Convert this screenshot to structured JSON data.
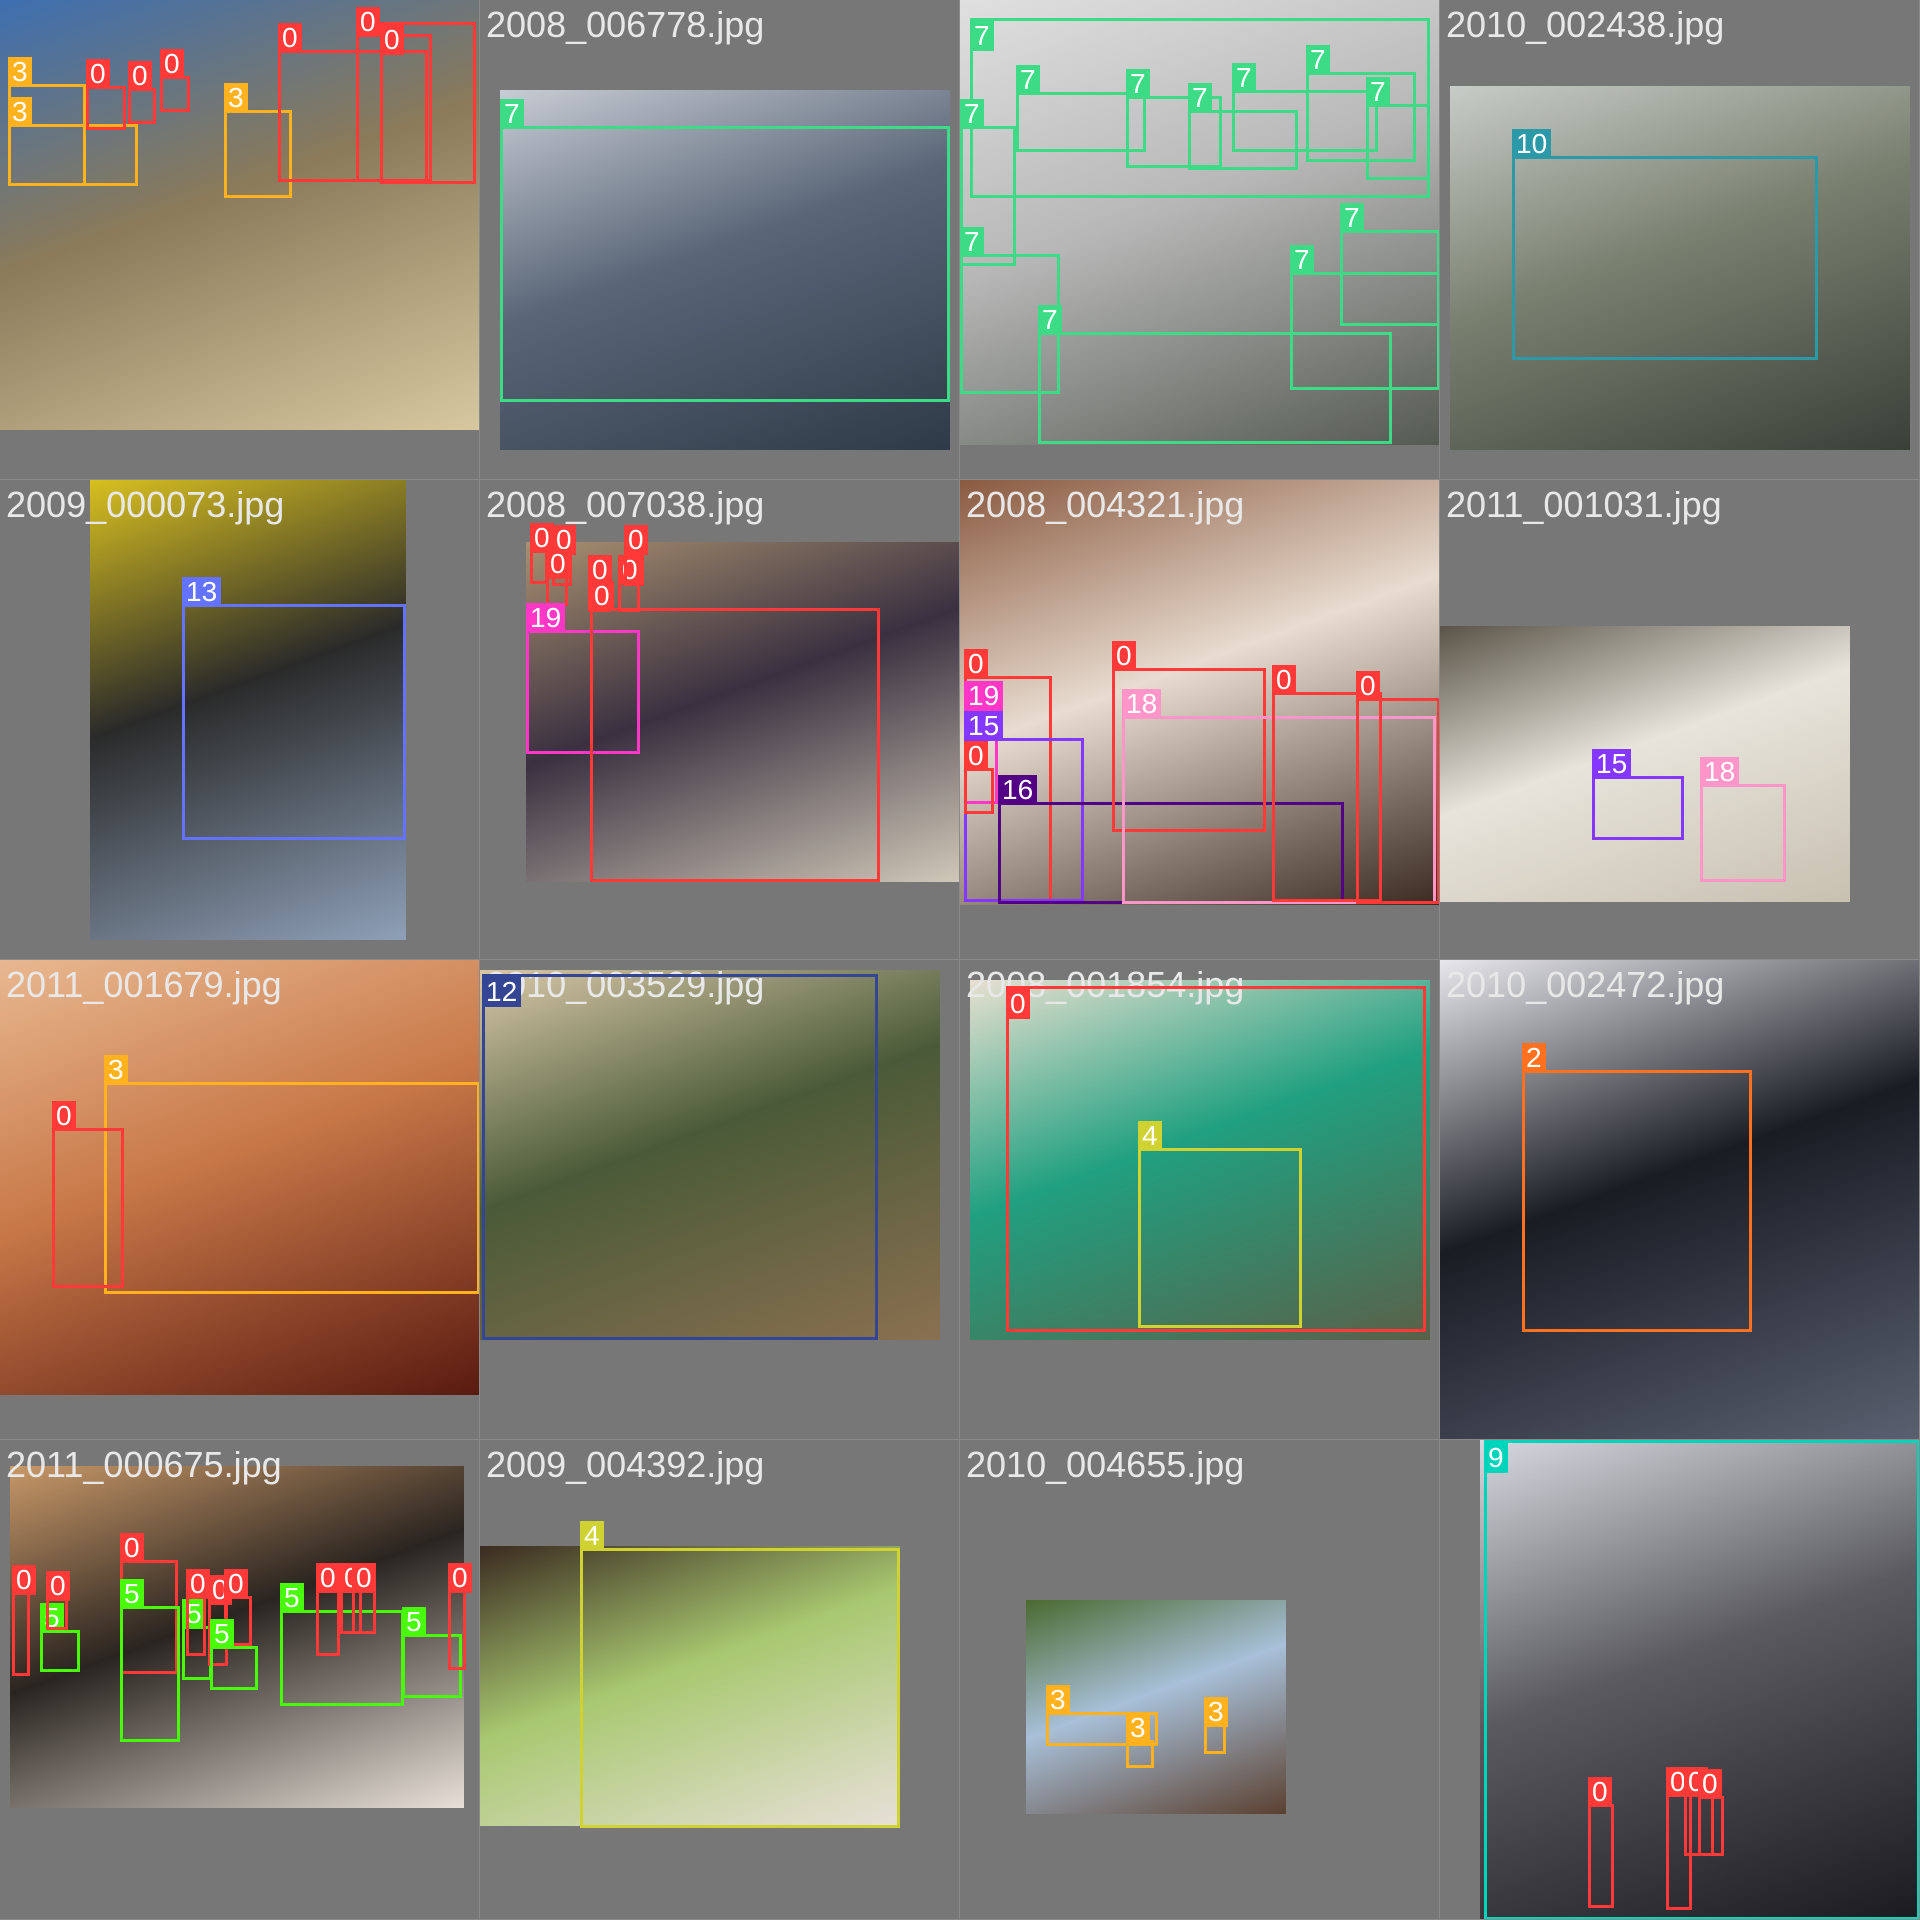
{
  "tiles": [
    {
      "filename": "",
      "photo_colors": [
        "#8a7a5a",
        "#3d6fb0",
        "#d8c8a0"
      ],
      "boxes": [
        {
          "label": "3",
          "color": "#FFB21D"
        },
        {
          "label": "3",
          "color": "#FFB21D"
        },
        {
          "label": "0",
          "color": "#FF3838"
        },
        {
          "label": "0",
          "color": "#FF3838"
        },
        {
          "label": "0",
          "color": "#FF3838"
        },
        {
          "label": "3",
          "color": "#FFB21D"
        },
        {
          "label": "0",
          "color": "#FF3838"
        },
        {
          "label": "0",
          "color": "#FF3838"
        },
        {
          "label": "0",
          "color": "#FF3838"
        }
      ]
    },
    {
      "filename": "2008_006778.jpg",
      "photo_colors": [
        "#5a6678",
        "#c8ccd4",
        "#2f3a48"
      ],
      "boxes": [
        {
          "label": "7",
          "color": "#3DDB86"
        }
      ]
    },
    {
      "filename": "",
      "photo_colors": [
        "#b8b8b8",
        "#e0e0e0",
        "#555a52"
      ],
      "boxes": [
        {
          "label": "7",
          "color": "#3DDB86"
        },
        {
          "label": "7",
          "color": "#3DDB86"
        },
        {
          "label": "7",
          "color": "#3DDB86"
        },
        {
          "label": "7",
          "color": "#3DDB86"
        },
        {
          "label": "7",
          "color": "#3DDB86"
        },
        {
          "label": "7",
          "color": "#3DDB86"
        },
        {
          "label": "7",
          "color": "#3DDB86"
        },
        {
          "label": "7",
          "color": "#3DDB86"
        },
        {
          "label": "7",
          "color": "#3DDB86"
        },
        {
          "label": "7",
          "color": "#3DDB86"
        },
        {
          "label": "7",
          "color": "#3DDB86"
        },
        {
          "label": "7",
          "color": "#3DDB86"
        }
      ]
    },
    {
      "filename": "2010_002438.jpg",
      "photo_colors": [
        "#7a8070",
        "#c8ccc8",
        "#3a4038"
      ],
      "boxes": [
        {
          "label": "10",
          "color": "#2C99A8"
        }
      ]
    },
    {
      "filename": "2009_000073.jpg",
      "photo_colors": [
        "#2a2a2a",
        "#d8c020",
        "#8ea0b8"
      ],
      "boxes": [
        {
          "label": "13",
          "color": "#6473FF"
        }
      ]
    },
    {
      "filename": "2008_007038.jpg",
      "photo_colors": [
        "#3a3040",
        "#a89070",
        "#d0c8b8"
      ],
      "boxes": [
        {
          "label": "0",
          "color": "#FF3838"
        },
        {
          "label": "0",
          "color": "#FF3838"
        },
        {
          "label": "0",
          "color": "#FF3838"
        },
        {
          "label": "0",
          "color": "#FF3838"
        },
        {
          "label": "0",
          "color": "#FF3838"
        },
        {
          "label": "0",
          "color": "#FF3838"
        },
        {
          "label": "19",
          "color": "#FF37C7"
        },
        {
          "label": "0",
          "color": "#FF3838"
        }
      ]
    },
    {
      "filename": "2008_004321.jpg",
      "photo_colors": [
        "#e8dcd0",
        "#8a5a40",
        "#3a2a20"
      ],
      "boxes": [
        {
          "label": "0",
          "color": "#FF3838"
        },
        {
          "label": "19",
          "color": "#FF37C7"
        },
        {
          "label": "15",
          "color": "#8438FF"
        },
        {
          "label": "0",
          "color": "#FF3838"
        },
        {
          "label": "16",
          "color": "#520085"
        },
        {
          "label": "0",
          "color": "#FF3838"
        },
        {
          "label": "18",
          "color": "#FF95C8"
        },
        {
          "label": "0",
          "color": "#FF3838"
        },
        {
          "label": "0",
          "color": "#FF3838"
        }
      ]
    },
    {
      "filename": "2011_001031.jpg",
      "photo_colors": [
        "#e8e4dc",
        "#5a5448",
        "#c8c0b0"
      ],
      "boxes": [
        {
          "label": "15",
          "color": "#8438FF"
        },
        {
          "label": "18",
          "color": "#FF95C8"
        }
      ]
    },
    {
      "filename": "2011_001679.jpg",
      "photo_colors": [
        "#c87848",
        "#e8b890",
        "#5a1a10"
      ],
      "boxes": [
        {
          "label": "3",
          "color": "#FFB21D"
        },
        {
          "label": "0",
          "color": "#FF3838"
        }
      ]
    },
    {
      "filename": "2010_003529.jpg",
      "photo_colors": [
        "#4a5a38",
        "#d8c8a8",
        "#8a7050"
      ],
      "boxes": [
        {
          "label": "12",
          "color": "#344593"
        }
      ]
    },
    {
      "filename": "2008_001854.jpg",
      "photo_colors": [
        "#20a080",
        "#e8e0d0",
        "#5a6048"
      ],
      "boxes": [
        {
          "label": "0",
          "color": "#FF3838"
        },
        {
          "label": "4",
          "color": "#CFD231"
        }
      ]
    },
    {
      "filename": "2010_002472.jpg",
      "photo_colors": [
        "#1a1c24",
        "#e8e8ec",
        "#5a6070"
      ],
      "boxes": [
        {
          "label": "2",
          "color": "#FF701F"
        }
      ]
    },
    {
      "filename": "2011_000675.jpg",
      "photo_colors": [
        "#2a2420",
        "#c89868",
        "#e8e0d8"
      ],
      "boxes": [
        {
          "label": "0",
          "color": "#FF3838"
        },
        {
          "label": "5",
          "color": "#48F90A"
        },
        {
          "label": "0",
          "color": "#FF3838"
        },
        {
          "label": "0",
          "color": "#FF3838"
        },
        {
          "label": "5",
          "color": "#48F90A"
        },
        {
          "label": "5",
          "color": "#48F90A"
        },
        {
          "label": "0",
          "color": "#FF3838"
        },
        {
          "label": "0",
          "color": "#FF3838"
        },
        {
          "label": "0",
          "color": "#FF3838"
        },
        {
          "label": "5",
          "color": "#48F90A"
        },
        {
          "label": "5",
          "color": "#48F90A"
        },
        {
          "label": "0",
          "color": "#FF3838"
        },
        {
          "label": "0",
          "color": "#FF3838"
        },
        {
          "label": "0",
          "color": "#FF3838"
        },
        {
          "label": "5",
          "color": "#48F90A"
        },
        {
          "label": "0",
          "color": "#FF3838"
        }
      ]
    },
    {
      "filename": "2009_004392.jpg",
      "photo_colors": [
        "#a8c870",
        "#3a2a20",
        "#e8e0d8"
      ],
      "boxes": [
        {
          "label": "4",
          "color": "#CFD231"
        }
      ]
    },
    {
      "filename": "2010_004655.jpg",
      "photo_colors": [
        "#a8c0d8",
        "#4a6a30",
        "#5a4030"
      ],
      "boxes": [
        {
          "label": "3",
          "color": "#FFB21D"
        },
        {
          "label": "3",
          "color": "#FFB21D"
        },
        {
          "label": "3",
          "color": "#FFB21D"
        }
      ]
    },
    {
      "filename": "",
      "photo_colors": [
        "#5a5a60",
        "#d8d8e0",
        "#1a1a20"
      ],
      "boxes": [
        {
          "label": "9",
          "color": "#00D4BB"
        },
        {
          "label": "0",
          "color": "#FF3838"
        },
        {
          "label": "0",
          "color": "#FF3838"
        },
        {
          "label": "0",
          "color": "#FF3838"
        },
        {
          "label": "0",
          "color": "#FF3838"
        }
      ]
    }
  ]
}
